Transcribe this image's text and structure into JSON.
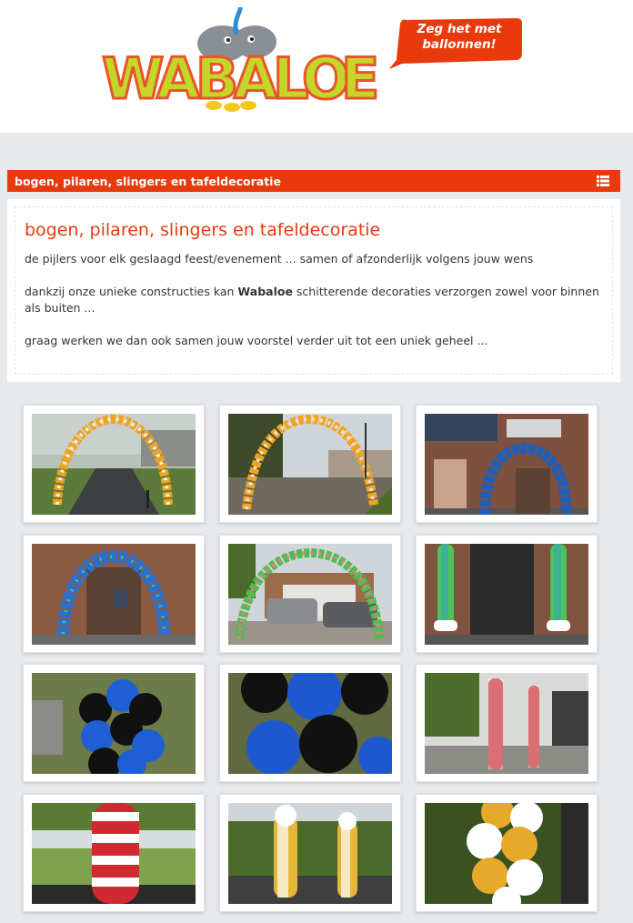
{
  "header": {
    "logo_text": "WABALOE",
    "bubble_line1": "Zeg het met",
    "bubble_line2": "ballonnen!"
  },
  "menubar": {
    "title": "bogen, pilaren, slingers en tafeldecoratie",
    "menu_icon": "list-icon"
  },
  "content": {
    "title": "bogen, pilaren, slingers en tafeldecoratie",
    "para1": "de pijlers voor elk geslaagd feest/evenement ... samen of afzonderlijk volgens jouw wens",
    "para2_before": "dankzij onze unieke constructies kan ",
    "para2_brand": "Wabaloe",
    "para2_after": " schitterende decoraties verzorgen zowel voor binnen als buiten ...",
    "para3": "graag werken we dan ook samen jouw voorstel verder uit tot een uniek geheel ..."
  },
  "gallery": {
    "photos": [
      {
        "subject": "orange-white balloon arch in park"
      },
      {
        "subject": "orange-white balloon arch at entrance"
      },
      {
        "subject": "blue balloon arch at garage door"
      },
      {
        "subject": "blue balloon arch at brick wall"
      },
      {
        "subject": "green-pink balloon arch over driveway"
      },
      {
        "subject": "green balloon columns at door"
      },
      {
        "subject": "black-blue balloon column close-up"
      },
      {
        "subject": "black-blue balloon column detail"
      },
      {
        "subject": "red-white balloon columns indoor"
      },
      {
        "subject": "red-white balloon column outdoor"
      },
      {
        "subject": "gold-white balloon columns with ghosts"
      },
      {
        "subject": "gold-white balloon column close-up"
      }
    ]
  },
  "colors": {
    "accent": "#e83a0c",
    "background": "#e6eaed"
  }
}
